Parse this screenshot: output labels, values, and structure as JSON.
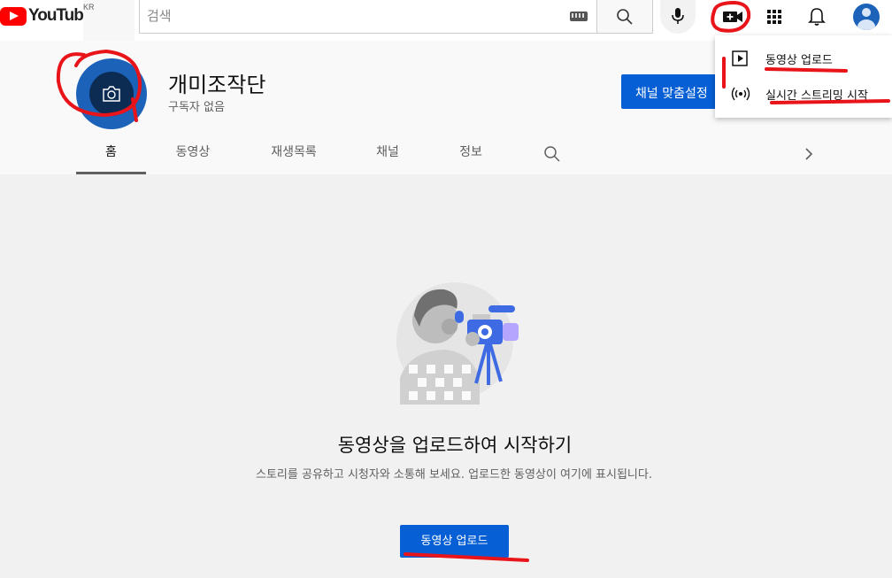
{
  "header": {
    "logo_text": "YouTube",
    "region": "KR",
    "search_placeholder": "검색"
  },
  "channel": {
    "name": "개미조작단",
    "subscribers": "구독자 없음",
    "customize_button": "채널 맞춤설정"
  },
  "tabs": [
    {
      "label": "홈",
      "active": true
    },
    {
      "label": "동영상"
    },
    {
      "label": "재생목록"
    },
    {
      "label": "채널"
    },
    {
      "label": "정보"
    }
  ],
  "create_menu": {
    "items": [
      {
        "label": "동영상 업로드",
        "icon": "play-box-icon"
      },
      {
        "label": "실시간 스트리밍 시작",
        "icon": "live-broadcast-icon"
      }
    ]
  },
  "empty_state": {
    "title": "동영상을 업로드하여 시작하기",
    "description": "스토리를 공유하고 시청자와 소통해 보세요. 업로드한 동영상이 여기에 표시됩니다.",
    "button": "동영상 업로드"
  },
  "colors": {
    "accent": "#065fd4",
    "brand": "#ff0000",
    "annotation": "#e8141a"
  }
}
